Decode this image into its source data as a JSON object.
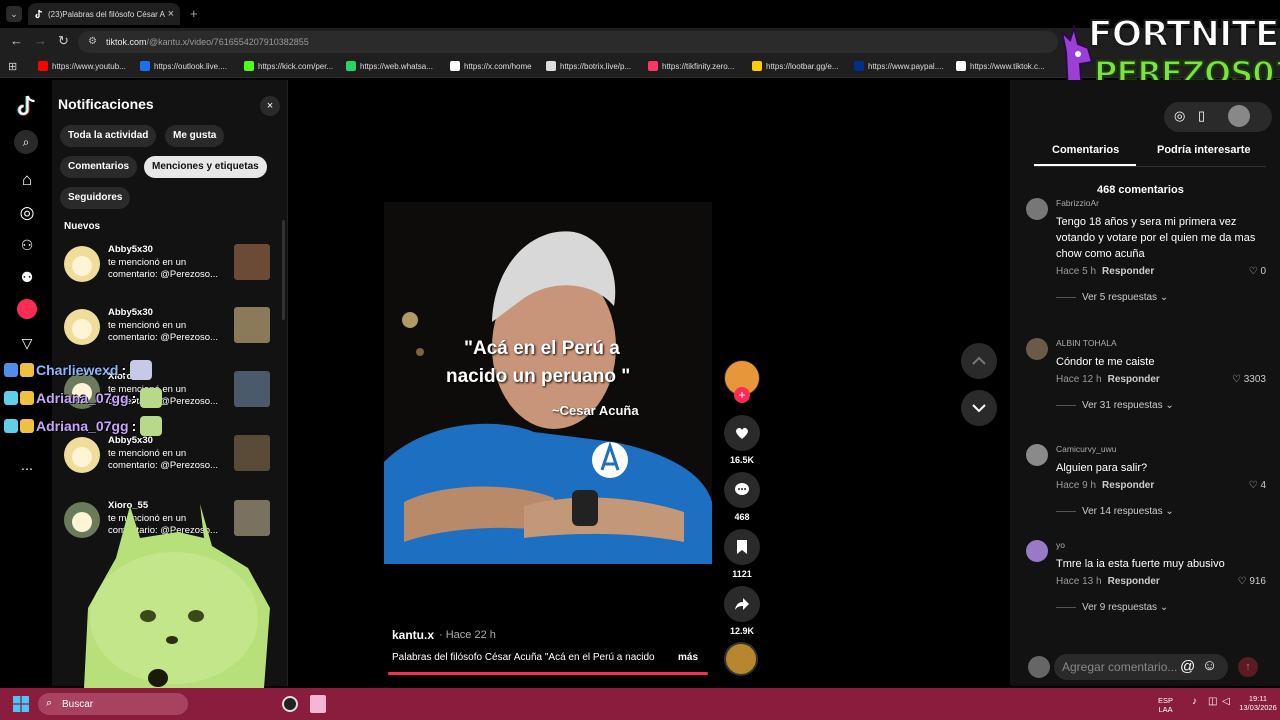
{
  "browser": {
    "tab_title": "(23)Palabras del filósofo César A",
    "tab_close": "×",
    "new_tab": "+",
    "url_host": "tiktok.com",
    "url_path": "/@kantu.x/video/7616554207910382855",
    "bookmarks": [
      {
        "label": "https://www.youtub...",
        "color": "#ff0000"
      },
      {
        "label": "https://outlook.live....",
        "color": "#1e6ff0"
      },
      {
        "label": "https://kick.com/per...",
        "color": "#53fc18"
      },
      {
        "label": "https://web.whatsa...",
        "color": "#25d366"
      },
      {
        "label": "https://x.com/home",
        "color": "#ffffff"
      },
      {
        "label": "https://botrix.live/p...",
        "color": "#dddddd"
      },
      {
        "label": "https://tikfinity.zero...",
        "color": "#ff3366"
      },
      {
        "label": "https://lootbar.gg/e...",
        "color": "#ffcc00"
      },
      {
        "label": "https://www.paypal....",
        "color": "#003087"
      },
      {
        "label": "https://www.tiktok.c...",
        "color": "#ffffff"
      }
    ]
  },
  "notifications": {
    "title": "Notificaciones",
    "close": "×",
    "chips": [
      "Toda la actividad",
      "Me gusta",
      "Comentarios",
      "Menciones y etiquetas",
      "Seguidores"
    ],
    "section": "Nuevos",
    "items": [
      {
        "name": "Abby5x30",
        "line1": "te mencionó en un",
        "line2": "comentario: @Perezoso..."
      },
      {
        "name": "Abby5x30",
        "line1": "te mencionó en un",
        "line2": "comentario: @Perezoso..."
      },
      {
        "name": "Xioro_55",
        "line1": "te mencionó en un",
        "line2": "comentario: @Perezoso..."
      },
      {
        "name": "Abby5x30",
        "line1": "te mencionó en un",
        "line2": "comentario: @Perezoso..."
      },
      {
        "name": "Xioro_55",
        "line1": "te mencionó en un",
        "line2": "comentario: @Perezoso..."
      }
    ]
  },
  "overlay": {
    "brand_line1": "FORTNITE",
    "brand_line2": "PEREZOS01",
    "chat": [
      {
        "name": "Charliewexd",
        "sep": ":"
      },
      {
        "name": "Adriana_07gg",
        "sep": ":"
      },
      {
        "name": "Adriana_07gg",
        "sep": ":"
      }
    ]
  },
  "video": {
    "caption_line1": "\"Acá en el Perú a",
    "caption_line2": "nacido un peruano \"",
    "caption_author": "~Cesar Acuña",
    "author": "kantu.x",
    "posted": "· Hace 22 h",
    "description": "Palabras del filósofo César Acuña \"Acá en el Perú a nacido",
    "more": "más",
    "likes": "16.5K",
    "comments": "468",
    "saves": "1121",
    "shares": "12.9K"
  },
  "comments_panel": {
    "tab_comments": "Comentarios",
    "tab_suggested": "Podría interesarte",
    "count": "468 comentarios",
    "reply_label": "Responder",
    "input_placeholder": "Agregar comentario...",
    "at_sign": "@",
    "items": [
      {
        "user": "FabrizzioAr",
        "text": "Tengo 18 años y sera mi primera vez votando y votare por el quien me da mas chow como acuña",
        "time": "Hace 5 h",
        "likes": "0",
        "replies": "Ver 5 respuestas"
      },
      {
        "user": "ALBIN TOHALA",
        "text": "Cóndor te me caiste",
        "time": "Hace 12 h",
        "likes": "3303",
        "replies": "Ver 31 respuestas"
      },
      {
        "user": "Camicurvy_uwu",
        "text": "Alguien para salir?",
        "time": "Hace 9 h",
        "likes": "4",
        "replies": "Ver 14 respuestas"
      },
      {
        "user": "yo",
        "text": "Tmre la ia esta fuerte muy abusivo",
        "time": "Hace 13 h",
        "likes": "916",
        "replies": "Ver 9 respuestas"
      }
    ]
  },
  "taskbar": {
    "search": "Buscar",
    "lang1": "ESP",
    "lang2": "LAA",
    "time": "19:11",
    "date": "13/03/2026"
  },
  "colors": {
    "accent": "#fe2c55",
    "taskbar": "#8a1c3e"
  }
}
